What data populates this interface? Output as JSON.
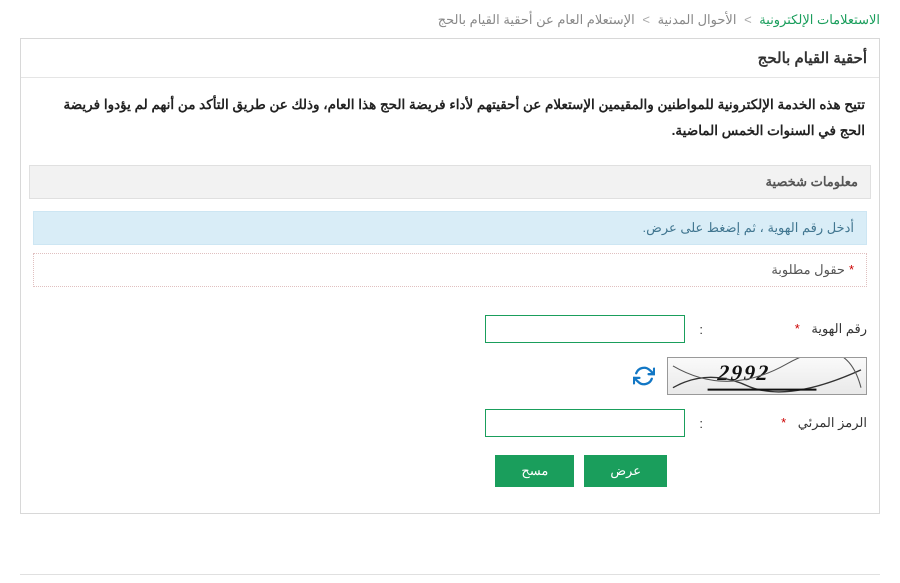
{
  "breadcrumb": {
    "root": "الاستعلامات الإلكترونية",
    "mid": "الأحوال المدنية",
    "current": "الإستعلام العام عن أحقية القيام بالحج"
  },
  "panel": {
    "title": "أحقية القيام بالحج",
    "description": "تتيح هذه الخدمة الإلكترونية للمواطنين والمقيمين الإستعلام عن أحقيتهم لأداء فريضة الحج هذا العام، وذلك عن طريق التأكد من أنهم لم يؤدوا فريضة الحج في السنوات الخمس الماضية."
  },
  "section": {
    "header": "معلومات شخصية",
    "info_strip": "أدخل رقم الهوية ، ثم إضغط على عرض.",
    "required_legend": "حقول مطلوبة"
  },
  "form": {
    "id_label": "رقم الهوية",
    "id_value": "",
    "captcha_value": "2992",
    "visual_code_label": "الرمز المرئي",
    "visual_code_value": ""
  },
  "buttons": {
    "submit": "عرض",
    "clear": "مسح"
  }
}
